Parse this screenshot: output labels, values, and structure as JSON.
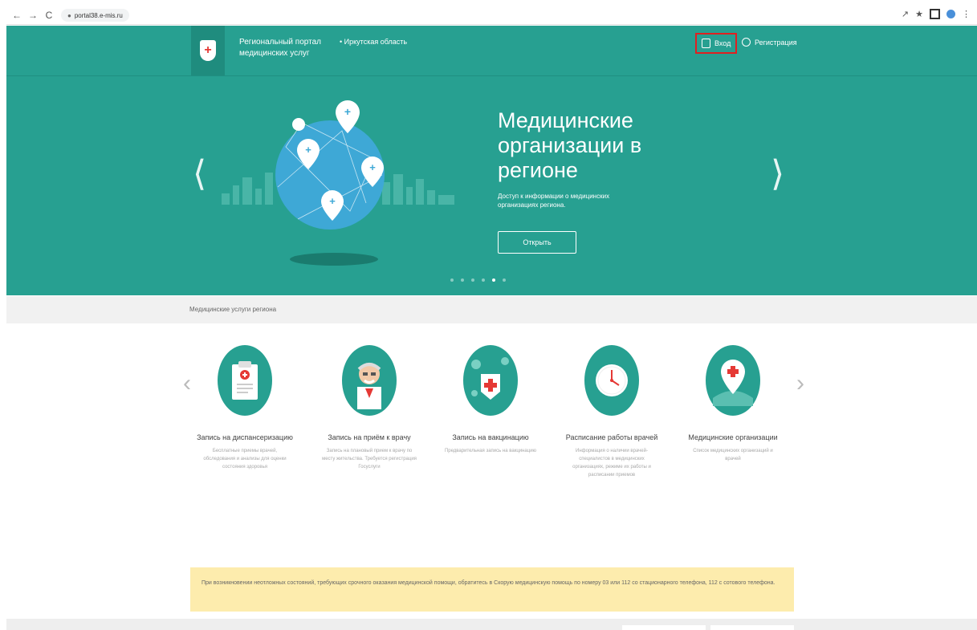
{
  "browser": {
    "url": "portal38.e-mis.ru",
    "back_glyph": "←",
    "forward_glyph": "→",
    "reload_glyph": "C",
    "star_glyph": "★"
  },
  "header": {
    "portal_title": "Региональный портал медицинских услуг",
    "region": "Иркутская область",
    "login": "Вход",
    "register": "Регистрация"
  },
  "hero": {
    "title": "Медицинские организации в регионе",
    "description": "Доступ к информации о медицинских организациях региона.",
    "button": "Открыть",
    "slide_count": 6,
    "active_slide": 5
  },
  "services": {
    "section_label": "Медицинские услуги региона",
    "items": [
      {
        "title": "Запись на диспансеризацию",
        "description": "Бесплатные приемы врачей, обследования и анализы для оценки состояния здоровья",
        "icon": "clipboard-icon"
      },
      {
        "title": "Запись на приём к врачу",
        "description": "Запись на плановый прием к врачу по месту жительства. Требуется регистрация Госуслуги",
        "icon": "doctor-icon"
      },
      {
        "title": "Запись на вакцинацию",
        "description": "Предварительная запись на вакцинацию",
        "icon": "vaccine-icon"
      },
      {
        "title": "Расписание работы врачей",
        "description": "Информация о наличии врачей-специалистов в медицинских организациях, режиме их работы и расписании приемов",
        "icon": "clock-icon"
      },
      {
        "title": "Медицинские организации",
        "description": "Список медицинских организаций и врачей",
        "icon": "map-pin-icon"
      }
    ]
  },
  "notice": {
    "text": "При возникновении неотложных состояний, требующих срочного оказания медицинской помощи, обратитесь в Скорую медицинскую помощь по номеру 03 или 112 со стационарного телефона, 112 с сотового телефона."
  },
  "colors": {
    "brand_green": "#27a091",
    "notice_yellow": "#fdecad",
    "highlight_red": "#e02020"
  }
}
